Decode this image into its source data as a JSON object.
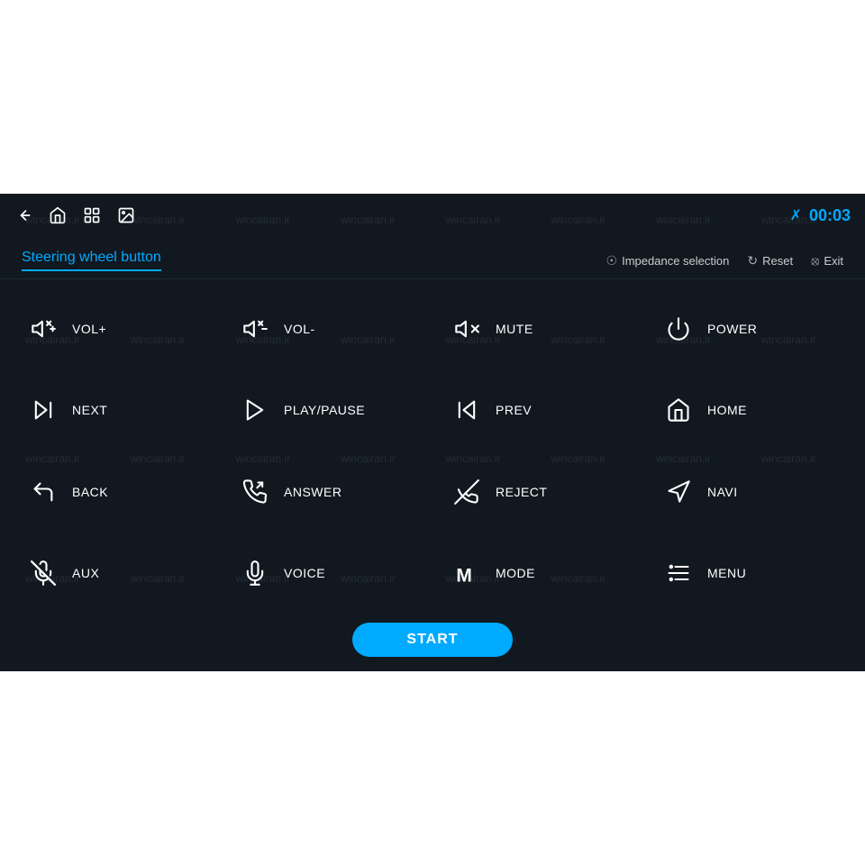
{
  "topbar": {
    "time": "00:03",
    "icons": [
      "back",
      "home",
      "recent",
      "gallery",
      "bluetooth"
    ]
  },
  "header": {
    "title": "Steering wheel button",
    "actions": [
      {
        "icon": "shield",
        "label": "Impedance selection"
      },
      {
        "icon": "reset",
        "label": "Reset"
      },
      {
        "icon": "exit",
        "label": "Exit"
      }
    ]
  },
  "buttons": [
    {
      "id": "vol-plus",
      "icon": "vol+",
      "label": "VOL+"
    },
    {
      "id": "vol-minus",
      "icon": "vol-",
      "label": "VOL-"
    },
    {
      "id": "mute",
      "icon": "mute",
      "label": "MUTE"
    },
    {
      "id": "power",
      "icon": "power",
      "label": "POWER"
    },
    {
      "id": "next",
      "icon": "next",
      "label": "NEXT"
    },
    {
      "id": "playpause",
      "icon": "playpause",
      "label": "PLAY/PAUSE"
    },
    {
      "id": "prev",
      "icon": "prev",
      "label": "PREV"
    },
    {
      "id": "home",
      "icon": "home",
      "label": "HOME"
    },
    {
      "id": "back",
      "icon": "back",
      "label": "BACK"
    },
    {
      "id": "answer",
      "icon": "answer",
      "label": "ANSWER"
    },
    {
      "id": "reject",
      "icon": "reject",
      "label": "REJECT"
    },
    {
      "id": "navi",
      "icon": "navi",
      "label": "NAVI"
    },
    {
      "id": "aux",
      "icon": "aux",
      "label": "AUX"
    },
    {
      "id": "voice",
      "icon": "voice",
      "label": "VOICE"
    },
    {
      "id": "mode",
      "icon": "mode",
      "label": "MODE"
    },
    {
      "id": "menu",
      "icon": "menu",
      "label": "MENU"
    }
  ],
  "start_button": "START",
  "watermarks": [
    "wincairan.ir",
    "wincairan.ir",
    "wincairan.ir",
    "wincairan.ir",
    "wincairan.ir",
    "wincairan.ir",
    "wincairan.ir",
    "wincairan.ir",
    "wincairan.ir",
    "wincairan.ir",
    "wincairan.ir",
    "wincairan.ir",
    "wincairan.ir",
    "wincairan.ir",
    "wincairan.ir",
    "wincairan.ir",
    "wincairan.ir",
    "wincairan.ir",
    "wincairan.ir",
    "wincairan.ir",
    "wincairan.ir",
    "wincairan.ir",
    "wincairan.ir",
    "wincairan.ir",
    "wincairan.ir",
    "wincairan.ir",
    "wincairan.ir",
    "wincairan.ir",
    "wincairan.ir",
    "wincairan.ir"
  ]
}
